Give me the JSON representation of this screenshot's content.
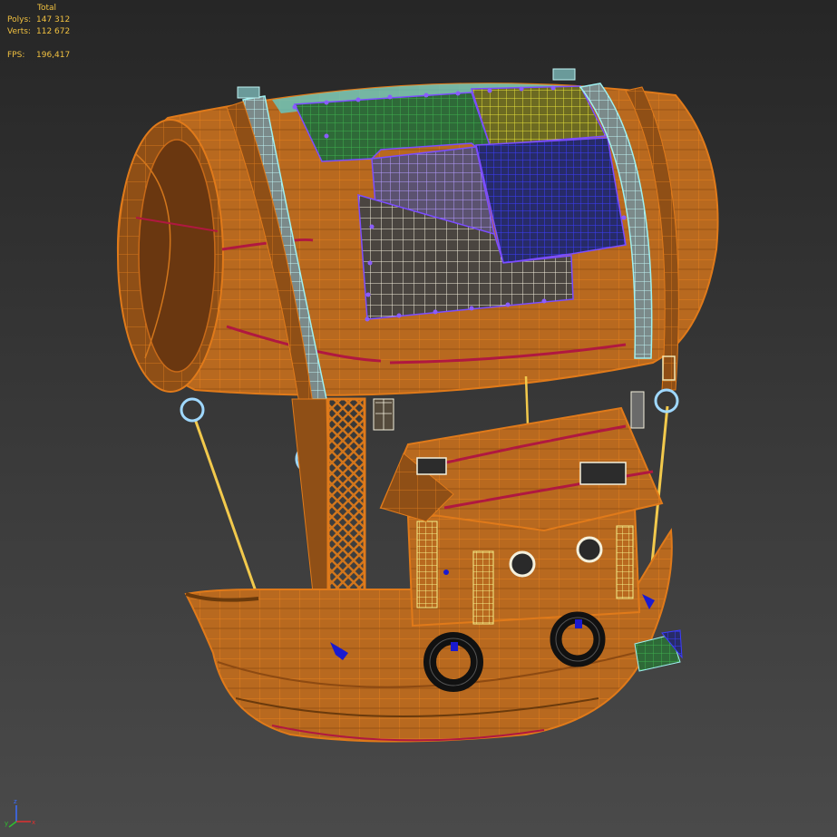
{
  "stats": {
    "title": "Total",
    "polys_label": "Polys:",
    "polys_value": "147 312",
    "verts_label": "Verts:",
    "verts_value": "112 672",
    "fps_label": "FPS:",
    "fps_value": "196,417"
  },
  "gizmo": {
    "x_axis": "x",
    "y_axis": "y",
    "z_axis": "z"
  },
  "colors": {
    "wood": "#b9691f",
    "wood_dark": "#6e3a0c",
    "wire": "#e07a1a",
    "rope": "#f2c94c",
    "strap": "#7fe0e0",
    "selection_vertex": "#7b4dff",
    "stats_text": "#f0c040"
  },
  "model": {
    "object_name": "airship-barrel-boat",
    "parts": [
      "barrel-balloon",
      "metal-straps",
      "rope-rings",
      "rigging-ropes",
      "mast-truss",
      "cabin",
      "cabin-roof",
      "hull",
      "life-rings",
      "lantern",
      "side-box"
    ]
  }
}
